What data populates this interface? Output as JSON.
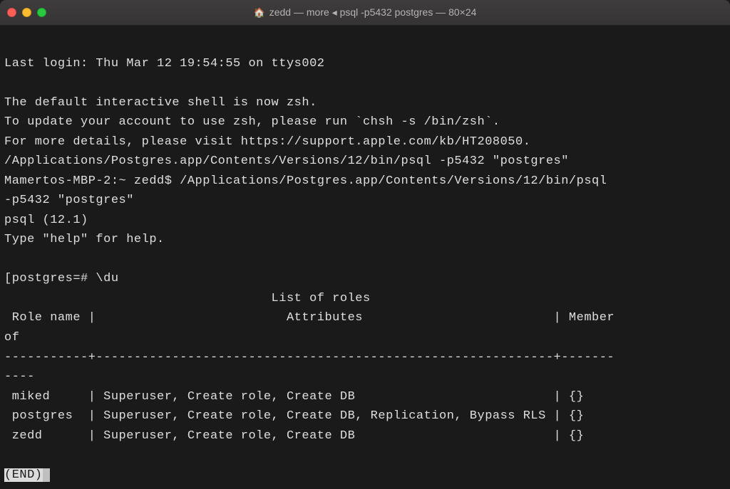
{
  "window": {
    "title": "zedd — more ◂ psql -p5432 postgres — 80×24"
  },
  "session": {
    "last_login": "Last login: Thu Mar 12 19:54:55 on ttys002",
    "blank1": "",
    "zsh_notice_1": "The default interactive shell is now zsh.",
    "zsh_notice_2": "To update your account to use zsh, please run `chsh -s /bin/zsh`.",
    "zsh_notice_3": "For more details, please visit https://support.apple.com/kb/HT208050.",
    "cmd_echo": "/Applications/Postgres.app/Contents/Versions/12/bin/psql -p5432 \"postgres\"",
    "prompt_line": "Mamertos-MBP-2:~ zedd$ /Applications/Postgres.app/Contents/Versions/12/bin/psql ",
    "prompt_line2": "-p5432 \"postgres\"",
    "psql_version": "psql (12.1)",
    "psql_help": "Type \"help\" for help.",
    "blank2": "",
    "psql_prompt": "[postgres=# \\du",
    "list_title": "                                   List of roles",
    "header": " Role name |                         Attributes                         | Member ",
    "header2": "of ",
    "divider": "-----------+------------------------------------------------------------+-------",
    "divider2": "----",
    "row_miked": " miked     | Superuser, Create role, Create DB                          | {}",
    "row_postgres": " postgres  | Superuser, Create role, Create DB, Replication, Bypass RLS | {}",
    "row_zedd": " zedd      | Superuser, Create role, Create DB                          | {}",
    "blank3": "",
    "end_marker": "(END)"
  },
  "roles_table": {
    "title": "List of roles",
    "columns": [
      "Role name",
      "Attributes",
      "Member of"
    ],
    "rows": [
      {
        "role_name": "miked",
        "attributes": "Superuser, Create role, Create DB",
        "member_of": "{}"
      },
      {
        "role_name": "postgres",
        "attributes": "Superuser, Create role, Create DB, Replication, Bypass RLS",
        "member_of": "{}"
      },
      {
        "role_name": "zedd",
        "attributes": "Superuser, Create role, Create DB",
        "member_of": "{}"
      }
    ]
  }
}
